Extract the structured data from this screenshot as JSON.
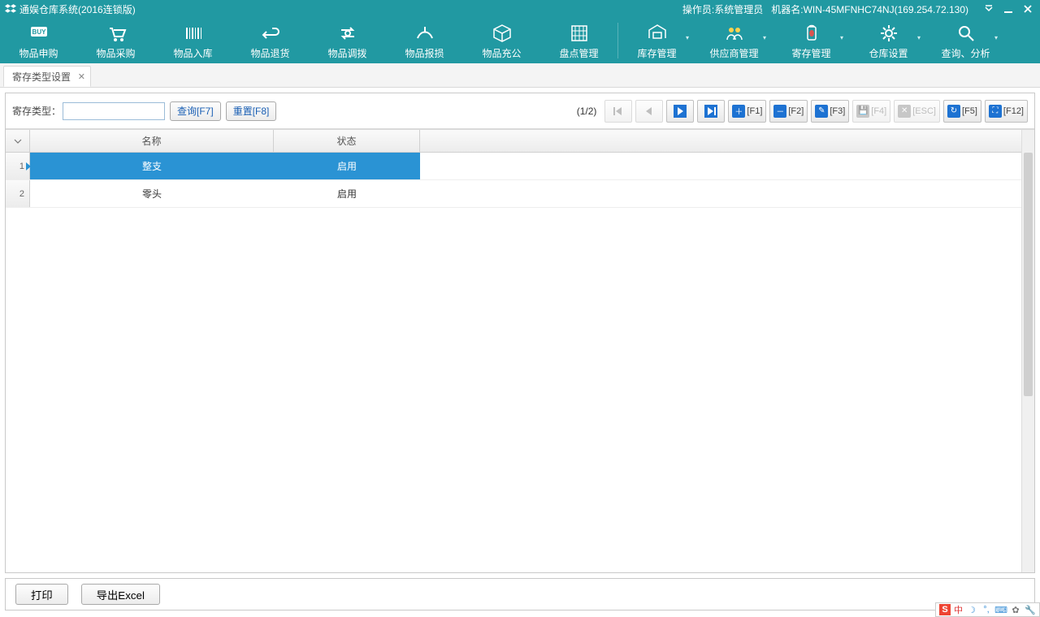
{
  "window": {
    "title": "通娱仓库系统(2016连锁版)",
    "operator_label": "操作员:",
    "operator": "系统管理员",
    "machine_label": "机器名:",
    "machine": "WIN-45MFNHC74NJ(169.254.72.130)"
  },
  "toolbar": [
    {
      "label": "物品申购",
      "icon": "buy"
    },
    {
      "label": "物品采购",
      "icon": "cart"
    },
    {
      "label": "物品入库",
      "icon": "barcode"
    },
    {
      "label": "物品退货",
      "icon": "return"
    },
    {
      "label": "物品调拨",
      "icon": "transfer"
    },
    {
      "label": "物品报损",
      "icon": "damage"
    },
    {
      "label": "物品充公",
      "icon": "box"
    },
    {
      "label": "盘点管理",
      "icon": "abacus"
    },
    {
      "label": "库存管理",
      "icon": "stock",
      "dd": true
    },
    {
      "label": "供应商管理",
      "icon": "supplier",
      "dd": true
    },
    {
      "label": "寄存管理",
      "icon": "deposit",
      "dd": true
    },
    {
      "label": "仓库设置",
      "icon": "settings",
      "dd": true
    },
    {
      "label": "查询、分析",
      "icon": "search",
      "dd": true
    }
  ],
  "tab": {
    "label": "寄存类型设置"
  },
  "filter": {
    "label": "寄存类型：",
    "value": "",
    "query_btn": "查询[F7]",
    "reset_btn": "重置[F8]"
  },
  "pager": {
    "text": "(1/2)"
  },
  "fnbuttons": {
    "f1": "[F1]",
    "f2": "[F2]",
    "f3": "[F3]",
    "f4": "[F4]",
    "esc": "[ESC]",
    "f5": "[F5]",
    "f12": "[F12]"
  },
  "grid": {
    "headers": {
      "name": "名称",
      "status": "状态"
    },
    "rows": [
      {
        "num": "1",
        "name": "整支",
        "status": "启用",
        "selected": true
      },
      {
        "num": "2",
        "name": "零头",
        "status": "启用",
        "selected": false
      }
    ]
  },
  "bottom": {
    "print": "打印",
    "export": "导出Excel"
  },
  "status": {
    "ime": "中"
  },
  "colors": {
    "primary": "#2199a2",
    "blue": "#1d72d2",
    "selected": "#2a93d4"
  }
}
